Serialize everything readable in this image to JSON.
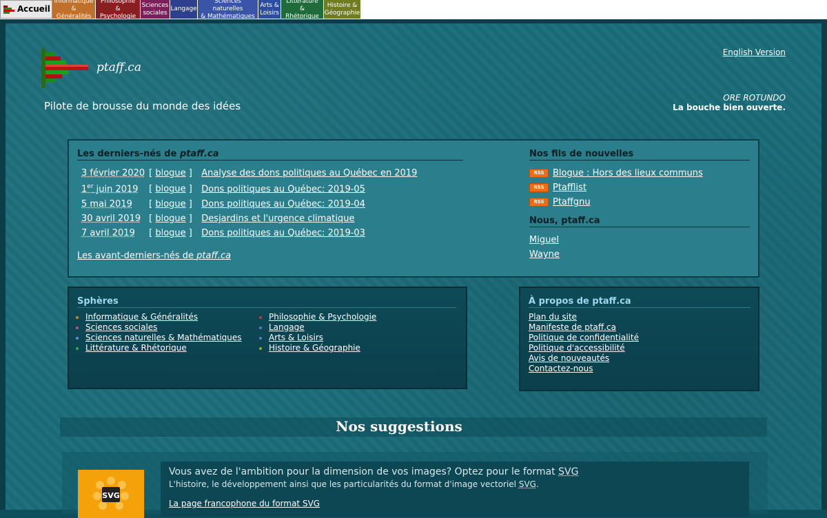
{
  "nav": {
    "home": "Accueil",
    "items": [
      {
        "line1": "Informatique",
        "line2": "& Généralités",
        "color": "#c0702a"
      },
      {
        "line1": "Philosophie",
        "line2": "& Psychologie",
        "color": "#8a1f22"
      },
      {
        "line1": "Sciences",
        "line2": "sociales",
        "color": "#7d1f5a"
      },
      {
        "line1": "Langage",
        "line2": "",
        "color": "#2e3f8f"
      },
      {
        "line1": "Sciences naturelles",
        "line2": "& Mathématiques",
        "color": "#3a55a8"
      },
      {
        "line1": "Arts &",
        "line2": "Loisirs",
        "color": "#2b4da3"
      },
      {
        "line1": "Littérature",
        "line2": "& Rhétorique",
        "color": "#1f6b3a"
      },
      {
        "line1": "Histoire &",
        "line2": "Géographie",
        "color": "#6f7c1f"
      }
    ]
  },
  "header": {
    "site_name": "ptaff.ca",
    "tagline": "Pilote de brousse du monde des idées",
    "english_link": "English Version",
    "motto_title": "ORE ROTUNDO",
    "motto_sub": "La bouche bien ouverte."
  },
  "news": {
    "heading_prefix": "Les derniers-nés de ",
    "heading_site": "ptaff.ca",
    "items": [
      {
        "date": "3 février 2020",
        "date_sup": "",
        "date_rest": "",
        "category": "blogue",
        "title": "Analyse des dons politiques au Québec en 2019"
      },
      {
        "date": "1",
        "date_sup": "er",
        "date_rest": " juin 2019",
        "category": "blogue",
        "title": "Dons politiques au Québec: 2019-05"
      },
      {
        "date": "5 mai 2019",
        "date_sup": "",
        "date_rest": "",
        "category": "blogue",
        "title": "Dons politiques au Québec: 2019-04"
      },
      {
        "date": "30 avril 2019",
        "date_sup": "",
        "date_rest": "",
        "category": "blogue",
        "title": "Desjardins et l'urgence climatique"
      },
      {
        "date": "7 avril 2019",
        "date_sup": "",
        "date_rest": "",
        "category": "blogue",
        "title": "Dons politiques au Québec: 2019-03"
      }
    ],
    "older_prefix": "Les avant-derniers-nés de ",
    "older_site": "ptaff.ca"
  },
  "feeds": {
    "heading": "Nos fils de nouvelles",
    "badge": "RSS",
    "items": [
      "Blogue : Hors des lieux communs",
      "Ptafflist",
      "Ptaffgnu"
    ]
  },
  "us": {
    "heading": "Nous, ptaff.ca",
    "items": [
      "Miguel",
      "Wayne"
    ]
  },
  "spheres": {
    "heading": "Sphères",
    "left": [
      {
        "label": "Informatique & Généralités",
        "color": "#d0842c"
      },
      {
        "label": "Sciences sociales",
        "color": "#c0507a"
      },
      {
        "label": "Sciences naturelles & Mathématiques",
        "color": "#6a88d8"
      },
      {
        "label": "Littérature & Rhétorique",
        "color": "#3fa060"
      }
    ],
    "right": [
      {
        "label": "Philosophie & Psychologie",
        "color": "#c03a3a"
      },
      {
        "label": "Langage",
        "color": "#5a7ad0"
      },
      {
        "label": "Arts & Loisirs",
        "color": "#5a7ad0"
      },
      {
        "label": "Histoire & Géographie",
        "color": "#9aa83a"
      }
    ]
  },
  "about": {
    "heading": "À propos de ptaff.ca",
    "items": [
      "Plan du site",
      "Manifeste de ptaff.ca",
      "Politique de confidentialité",
      "Politique d'accessibilité",
      "Avis de nouveautés",
      "Contactez-nous"
    ]
  },
  "suggestions": {
    "heading": "Nos suggestions",
    "logo_text": "SVG",
    "line1_prefix": "Vous avez de l'ambition pour la dimension de vos images? Optez pour le format ",
    "line1_abbr": "SVG",
    "line2_prefix": "L'histoire, le développement ainsi que les particularités du format d'image vectoriel ",
    "line2_abbr": "SVG",
    "line2_suffix": ".",
    "link": "La page francophone du format SVG"
  }
}
